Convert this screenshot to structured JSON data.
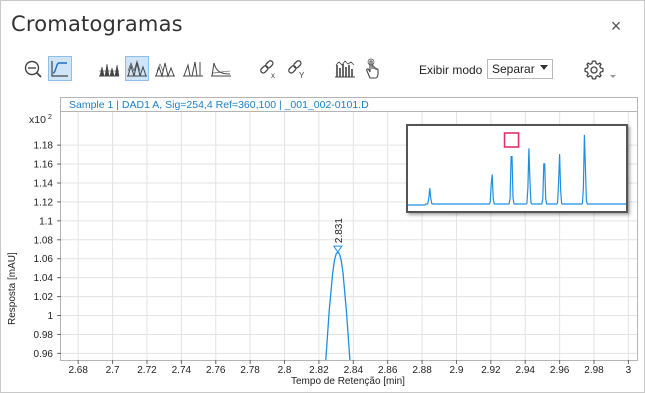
{
  "window": {
    "title": "Cromatogramas",
    "close_glyph": "×"
  },
  "toolbar": {
    "buttons": [
      {
        "name": "zoom-fit-icon",
        "active": false
      },
      {
        "name": "peak-shape-icon",
        "active": true
      },
      {
        "name": "overlay-peaks-icon",
        "active": false
      },
      {
        "name": "stack-peaks-icon",
        "active": true
      },
      {
        "name": "separate-peaks-icon",
        "active": false
      },
      {
        "name": "mirror-peaks-icon",
        "active": false
      },
      {
        "name": "offset-peaks-icon",
        "active": false
      },
      {
        "name": "link-x-icon",
        "active": false
      },
      {
        "name": "link-y-icon",
        "active": false
      },
      {
        "name": "bar-signal-icon",
        "active": false
      },
      {
        "name": "hand-pan-icon",
        "active": false
      }
    ],
    "mode_label": "Exibir modo",
    "mode_value": "Separar",
    "settings_icon": "gear-icon"
  },
  "chart_data": {
    "type": "line",
    "sample_label": "Sample 1 | DAD1 A, Sig=254,4 Ref=360,100 | _001_002-0101.D",
    "xlabel": "Tempo de Retenção [min]",
    "ylabel": "Resposta [mAU]",
    "y_multiplier": "x10",
    "y_multiplier_exp": "2",
    "xlim": [
      2.67,
      3.005
    ],
    "ylim": [
      0.953,
      1.215
    ],
    "x_ticks": [
      "2.68",
      "2.7",
      "2.72",
      "2.74",
      "2.76",
      "2.78",
      "2.8",
      "2.82",
      "2.84",
      "2.86",
      "2.88",
      "2.9",
      "2.92",
      "2.94",
      "2.96",
      "2.98",
      "3"
    ],
    "y_ticks": [
      "1.18",
      "1.16",
      "1.14",
      "1.12",
      "1.1",
      "1.08",
      "1.06",
      "1.04",
      "1.02",
      "1",
      "0.98",
      "0.96"
    ],
    "grid": true,
    "peak_annotation": {
      "x": 2.831,
      "label": "2.831",
      "y": 1.067
    },
    "series": [
      {
        "x": [
          2.824,
          2.826,
          2.828,
          2.829,
          2.83,
          2.831,
          2.832,
          2.833,
          2.834,
          2.836,
          2.838
        ],
        "y": [
          0.953,
          1.005,
          1.045,
          1.058,
          1.065,
          1.067,
          1.065,
          1.058,
          1.045,
          1.005,
          0.953
        ]
      }
    ],
    "colors": {
      "trace": "#1e8fe0",
      "marker": "#1e8fe0",
      "zoom_box": "#e0306a"
    }
  },
  "inset": {
    "peaks": [
      {
        "pos": 0.1,
        "h": 0.22
      },
      {
        "pos": 0.385,
        "h": 0.45
      },
      {
        "pos": 0.475,
        "h": 0.85
      },
      {
        "pos": 0.555,
        "h": 0.78
      },
      {
        "pos": 0.625,
        "h": 0.72
      },
      {
        "pos": 0.695,
        "h": 0.7
      },
      {
        "pos": 0.81,
        "h": 1.0
      }
    ],
    "zoom_box_center": 0.475
  }
}
